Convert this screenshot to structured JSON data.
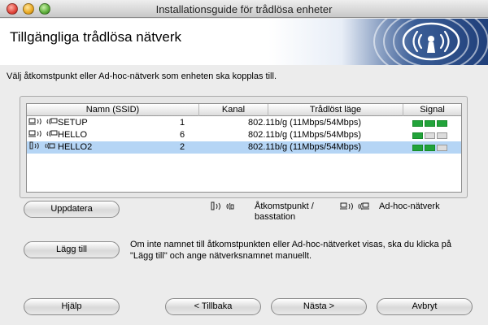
{
  "window": {
    "title": "Installationsguide för trådlösa enheter",
    "colors": {
      "selection": "#b5d5f5",
      "signal_on": "#22a33a",
      "signal_off": "#dcdcdc",
      "banner_blue": "#1f3f7a"
    }
  },
  "header": {
    "title": "Tillgängliga trådlösa nätverk",
    "logo_icon": "wireless-signal-logo-icon"
  },
  "instruction": "Välj åtkomstpunkt eller Ad-hoc-nätverk som enheten ska kopplas till.",
  "networks": {
    "columns": [
      "Namn (SSID)",
      "Kanal",
      "Trådlöst läge",
      "Signal"
    ],
    "rows": [
      {
        "type": "adhoc",
        "type_icon": "adhoc-network-icon",
        "ssid": "SETUP",
        "channel": "1",
        "mode": "802.11b/g (11Mbps/54Mbps)",
        "signal": 3,
        "selected": false
      },
      {
        "type": "adhoc",
        "type_icon": "adhoc-network-icon",
        "ssid": "HELLO",
        "channel": "6",
        "mode": "802.11b/g (11Mbps/54Mbps)",
        "signal": 1,
        "selected": false
      },
      {
        "type": "access_point",
        "type_icon": "access-point-icon",
        "ssid": "HELLO2",
        "channel": "2",
        "mode": "802.11b/g (11Mbps/54Mbps)",
        "signal": 2,
        "selected": true
      }
    ],
    "signal_max": 3
  },
  "buttons": {
    "refresh": "Uppdatera",
    "add": "Lägg till",
    "help": "Hjälp",
    "back": "< Tillbaka",
    "next": "Nästa >",
    "cancel": "Avbryt"
  },
  "legend": {
    "access_point_line1": "Åtkomstpunkt /",
    "access_point_line2": "basstation",
    "adhoc": "Ad-hoc-nätverk"
  },
  "info_text": "Om inte namnet till åtkomstpunkten eller Ad-hoc-nätverket visas, ska du klicka på \"Lägg till\" och ange nätverksnamnet manuellt."
}
